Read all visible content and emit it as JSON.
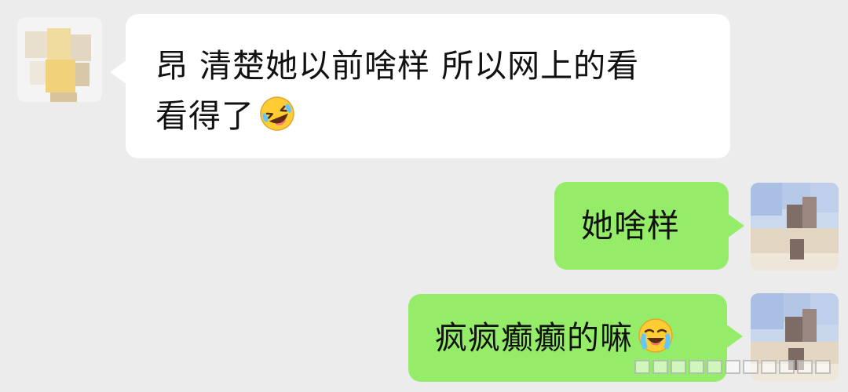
{
  "messages": [
    {
      "side": "left",
      "line1": "昂 清楚她以前啥样 所以网上的看",
      "line2": "看得了",
      "emoji": "rolling-on-floor-laughing-emoji"
    },
    {
      "side": "right",
      "text": "她啥样"
    },
    {
      "side": "right",
      "text": "疯疯癫癫的嘛",
      "emoji": "loudly-crying-laughing-emoji"
    }
  ],
  "colors": {
    "background": "#ececec",
    "incoming_bubble": "#ffffff",
    "outgoing_bubble": "#95ec69",
    "text": "#111111"
  }
}
